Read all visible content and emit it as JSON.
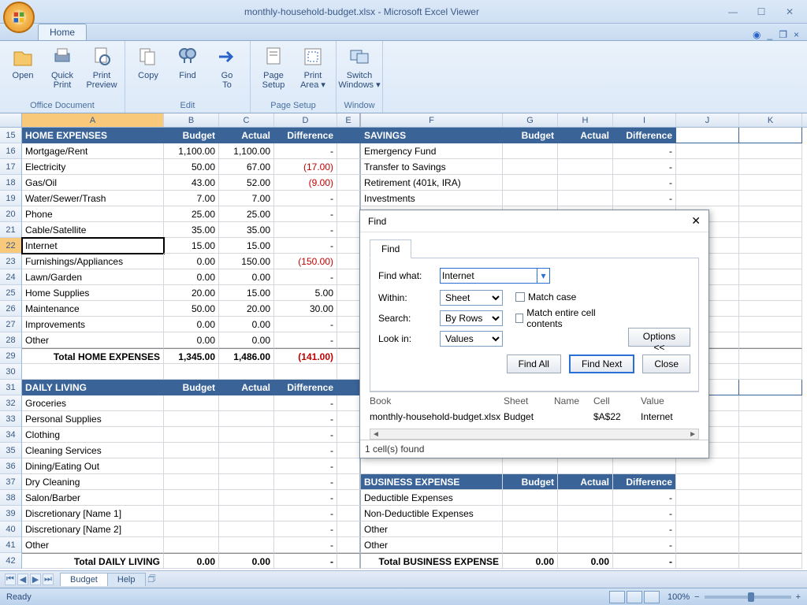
{
  "app": {
    "title": "monthly-household-budget.xlsx - Microsoft Excel Viewer"
  },
  "tabs": {
    "home": "Home"
  },
  "ribbon": {
    "office_document": {
      "label": "Office Document",
      "open": "Open",
      "quick_print": "Quick\nPrint",
      "print_preview": "Print\nPreview"
    },
    "edit": {
      "label": "Edit",
      "copy": "Copy",
      "find": "Find",
      "goto": "Go\nTo"
    },
    "page_setup": {
      "label": "Page Setup",
      "page_setup_btn": "Page\nSetup",
      "print_area": "Print\nArea ▾"
    },
    "window": {
      "label": "Window",
      "switch_windows": "Switch\nWindows ▾"
    }
  },
  "columns": [
    "A",
    "B",
    "C",
    "D",
    "E",
    "F",
    "G",
    "H",
    "I",
    "J",
    "K"
  ],
  "left_section": {
    "header": {
      "title": "HOME EXPENSES",
      "budget": "Budget",
      "actual": "Actual",
      "diff": "Difference"
    },
    "rows": [
      {
        "rn": "16",
        "label": "Mortgage/Rent",
        "b": "1,100.00",
        "a": "1,100.00",
        "d": "-"
      },
      {
        "rn": "17",
        "label": "Electricity",
        "b": "50.00",
        "a": "67.00",
        "d": "(17.00)",
        "neg": true
      },
      {
        "rn": "18",
        "label": "Gas/Oil",
        "b": "43.00",
        "a": "52.00",
        "d": "(9.00)",
        "neg": true
      },
      {
        "rn": "19",
        "label": "Water/Sewer/Trash",
        "b": "7.00",
        "a": "7.00",
        "d": "-"
      },
      {
        "rn": "20",
        "label": "Phone",
        "b": "25.00",
        "a": "25.00",
        "d": "-"
      },
      {
        "rn": "21",
        "label": "Cable/Satellite",
        "b": "35.00",
        "a": "35.00",
        "d": "-"
      },
      {
        "rn": "22",
        "label": "Internet",
        "b": "15.00",
        "a": "15.00",
        "d": "-",
        "sel": true
      },
      {
        "rn": "23",
        "label": "Furnishings/Appliances",
        "b": "0.00",
        "a": "150.00",
        "d": "(150.00)",
        "neg": true
      },
      {
        "rn": "24",
        "label": "Lawn/Garden",
        "b": "0.00",
        "a": "0.00",
        "d": "-"
      },
      {
        "rn": "25",
        "label": "Home Supplies",
        "b": "20.00",
        "a": "15.00",
        "d": "5.00"
      },
      {
        "rn": "26",
        "label": "Maintenance",
        "b": "50.00",
        "a": "20.00",
        "d": "30.00"
      },
      {
        "rn": "27",
        "label": "Improvements",
        "b": "0.00",
        "a": "0.00",
        "d": "-"
      },
      {
        "rn": "28",
        "label": "Other",
        "b": "0.00",
        "a": "0.00",
        "d": "-"
      }
    ],
    "total": {
      "rn": "29",
      "label": "Total HOME EXPENSES",
      "b": "1,345.00",
      "a": "1,486.00",
      "d": "(141.00)",
      "neg": true
    },
    "blank_rn": "30",
    "header2": {
      "rn": "31",
      "title": "DAILY LIVING",
      "budget": "Budget",
      "actual": "Actual",
      "diff": "Difference"
    },
    "rows2": [
      {
        "rn": "32",
        "label": "Groceries",
        "d": "-"
      },
      {
        "rn": "33",
        "label": "Personal Supplies",
        "d": "-"
      },
      {
        "rn": "34",
        "label": "Clothing",
        "d": "-"
      },
      {
        "rn": "35",
        "label": "Cleaning Services",
        "d": "-"
      },
      {
        "rn": "36",
        "label": "Dining/Eating Out",
        "d": "-"
      },
      {
        "rn": "37",
        "label": "Dry Cleaning",
        "d": "-"
      },
      {
        "rn": "38",
        "label": "Salon/Barber",
        "d": "-"
      },
      {
        "rn": "39",
        "label": "Discretionary [Name 1]",
        "d": "-"
      },
      {
        "rn": "40",
        "label": "Discretionary [Name 2]",
        "d": "-"
      },
      {
        "rn": "41",
        "label": "Other",
        "d": "-"
      }
    ],
    "total2": {
      "rn": "42",
      "label": "Total DAILY LIVING",
      "b": "0.00",
      "a": "0.00",
      "d": "-"
    }
  },
  "right_section": {
    "header": {
      "title": "SAVINGS",
      "budget": "Budget",
      "actual": "Actual",
      "diff": "Difference"
    },
    "rows": [
      {
        "label": "Emergency Fund",
        "d": "-"
      },
      {
        "label": "Transfer to Savings",
        "d": "-"
      },
      {
        "label": "Retirement (401k, IRA)",
        "d": "-"
      },
      {
        "label": "Investments",
        "d": "-"
      }
    ],
    "header2": {
      "title": "BUSINESS EXPENSE",
      "budget": "Budget",
      "actual": "Actual",
      "diff": "Difference"
    },
    "rows2": [
      {
        "label": "Deductible Expenses",
        "d": "-"
      },
      {
        "label": "Non-Deductible Expenses",
        "d": "-"
      },
      {
        "label": "Other",
        "d": "-"
      },
      {
        "label": "Other",
        "d": "-"
      }
    ],
    "total2": {
      "label": "Total BUSINESS EXPENSE",
      "b": "0.00",
      "a": "0.00",
      "d": "-"
    }
  },
  "find": {
    "title": "Find",
    "tab": "Find",
    "find_what_label": "Find what:",
    "find_what_value": "Internet",
    "within_label": "Within:",
    "within_value": "Sheet",
    "search_label": "Search:",
    "search_value": "By Rows",
    "lookin_label": "Look in:",
    "lookin_value": "Values",
    "match_case": "Match case",
    "match_entire": "Match entire cell contents",
    "options_btn": "Options <<",
    "find_all": "Find All",
    "find_next": "Find Next",
    "close": "Close",
    "col_book": "Book",
    "col_sheet": "Sheet",
    "col_name": "Name",
    "col_cell": "Cell",
    "col_value": "Value",
    "r_book": "monthly-household-budget.xlsx",
    "r_sheet": "Budget",
    "r_name": "",
    "r_cell": "$A$22",
    "r_value": "Internet",
    "status": "1 cell(s) found"
  },
  "sheets": {
    "s1": "Budget",
    "s2": "Help"
  },
  "status": {
    "ready": "Ready",
    "zoom": "100%"
  }
}
